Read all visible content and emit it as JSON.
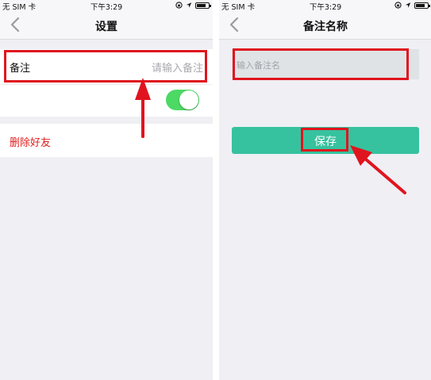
{
  "status_bar": {
    "carrier": "无 SIM 卡",
    "time": "下午3:29",
    "icons": [
      "wifi-icon",
      "lock-rotation-icon",
      "location-icon",
      "battery-icon"
    ]
  },
  "left_screen": {
    "title": "设置",
    "back_icon": "chevron-left-icon",
    "remark": {
      "label": "备注",
      "hint": "请输入备注"
    },
    "toggle": {
      "state": "on",
      "color": "#4cd964"
    },
    "delete_label": "删除好友",
    "delete_color": "#e02020"
  },
  "right_screen": {
    "title": "备注名称",
    "back_icon": "chevron-left-icon",
    "input": {
      "value": "",
      "placeholder": "输入备注名"
    },
    "save_label": "保存",
    "button_color": "#36c29e"
  },
  "annotations": {
    "highlight_color": "#e0141e",
    "arrow_icon": "red-arrow-icon"
  }
}
